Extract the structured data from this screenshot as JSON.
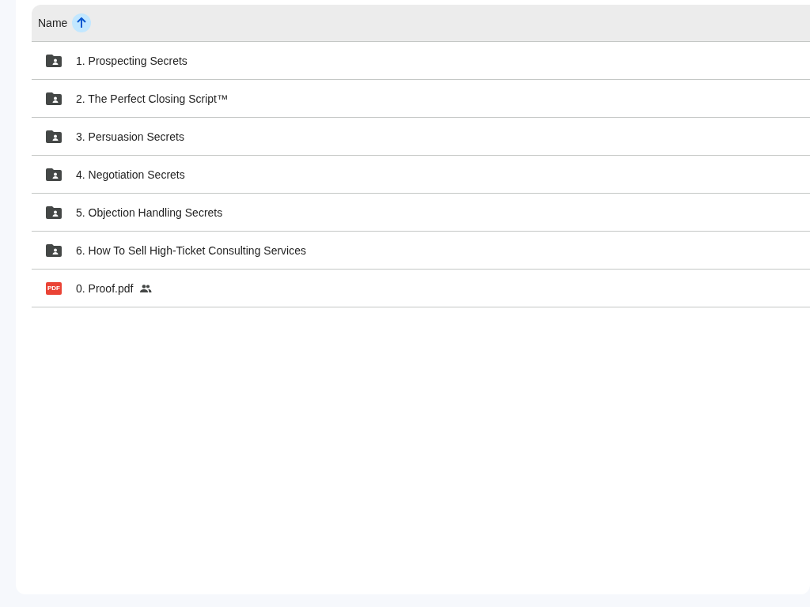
{
  "header": {
    "column": "Name",
    "sort_ascending": true
  },
  "files": [
    {
      "kind": "folder",
      "name": "1. Prospecting Secrets",
      "shared": false
    },
    {
      "kind": "folder",
      "name": "2. The Perfect Closing Script™",
      "shared": false
    },
    {
      "kind": "folder",
      "name": "3. Persuasion Secrets",
      "shared": false
    },
    {
      "kind": "folder",
      "name": "4. Negotiation Secrets",
      "shared": false
    },
    {
      "kind": "folder",
      "name": "5. Objection Handling Secrets",
      "shared": false
    },
    {
      "kind": "folder",
      "name": "6. How To Sell High-Ticket Consulting Services",
      "shared": false
    },
    {
      "kind": "pdf",
      "name": "0. Proof.pdf",
      "badge": "PDF",
      "shared": true
    }
  ]
}
